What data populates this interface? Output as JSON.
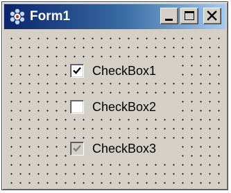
{
  "window": {
    "title": "Form1",
    "icon": "form-app-icon"
  },
  "title_buttons": {
    "minimize_icon": "minimize-icon",
    "maximize_icon": "maximize-icon",
    "close_icon": "close-icon"
  },
  "checkboxes": [
    {
      "label": "CheckBox1",
      "checked": true,
      "enabled": true
    },
    {
      "label": "CheckBox2",
      "checked": false,
      "enabled": true
    },
    {
      "label": "CheckBox3",
      "checked": true,
      "enabled": false
    }
  ],
  "colors": {
    "title_gradient_start": "#0a246a",
    "title_gradient_end": "#a6caf0",
    "face": "#d4d0c8",
    "disabled_check": "#808080"
  }
}
